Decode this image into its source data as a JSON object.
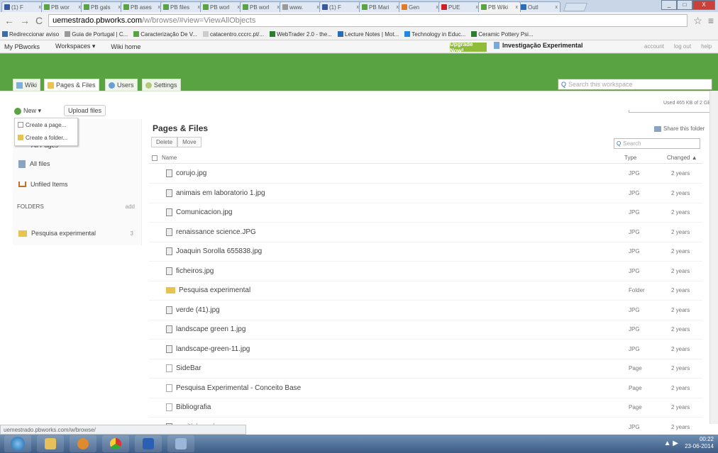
{
  "browser": {
    "tabs": [
      {
        "label": "(1) F",
        "color": "#3b5998"
      },
      {
        "label": "PB wor",
        "color": "#5aa342"
      },
      {
        "label": "PB gals",
        "color": "#5aa342"
      },
      {
        "label": "PB ases",
        "color": "#5aa342"
      },
      {
        "label": "PB files",
        "color": "#5aa342"
      },
      {
        "label": "PB worl",
        "color": "#5aa342"
      },
      {
        "label": "PB worl",
        "color": "#5aa342"
      },
      {
        "label": "www.",
        "color": "#999999"
      },
      {
        "label": "(1) F",
        "color": "#3b5998"
      },
      {
        "label": "PB Mari",
        "color": "#5aa342"
      },
      {
        "label": "Gen",
        "color": "#e07b2a"
      },
      {
        "label": "PUE",
        "color": "#cb2027"
      },
      {
        "label": "PB Wiki",
        "color": "#5aa342",
        "active": true
      },
      {
        "label": "Outl",
        "color": "#2b6cb8"
      }
    ],
    "url_host": "uemestrado.pbworks.com",
    "url_path": "/w/browse/#view=ViewAllObjects",
    "bookmarks": [
      {
        "label": "Redireccionar aviso",
        "color": "#3a6ea5"
      },
      {
        "label": "Guia de Portugal | C...",
        "color": "#999999"
      },
      {
        "label": "Caracterização De V...",
        "color": "#5aa342"
      },
      {
        "label": "catacentro.cccrc.pt/...",
        "color": "#cccccc"
      },
      {
        "label": "WebTrader 2.0 - the...",
        "color": "#2e7d32"
      },
      {
        "label": "Lecture Notes | Mot...",
        "color": "#2b6cb8"
      },
      {
        "label": "Technology in Educ...",
        "color": "#1e88e5"
      },
      {
        "label": "Ceramic Pottery Psi...",
        "color": "#2e7d32"
      }
    ]
  },
  "pbheader": {
    "brand": "My PBworks",
    "workspaces": "Workspaces ▾",
    "wiki_home": "Wiki home",
    "upgrade": "Upgrade Now!",
    "workspace_name": "Investigação Experimental",
    "account": "account",
    "logout": "log out",
    "help": "help"
  },
  "tabs": [
    {
      "label": "Wiki"
    },
    {
      "label": "Pages & Files"
    },
    {
      "label": "Users"
    },
    {
      "label": "Settings"
    }
  ],
  "search_placeholder": "Search this workspace",
  "toolbar": {
    "new": "New ▾",
    "upload": "Upload files"
  },
  "usage": "Used 465 KB of 2 GB",
  "new_menu": {
    "create_page": "Create a page...",
    "create_folder": "Create a folder..."
  },
  "sidebar": {
    "all_pages": "All Pages",
    "all_files": "All files",
    "unfiled": "Unfiled Items",
    "folders_label": "FOLDERS",
    "add": "add",
    "folder1": "Pesquisa experimental",
    "folder1_count": "3"
  },
  "main": {
    "title": "Pages & Files",
    "share": "Share this folder",
    "delete": "Delete",
    "move": "Move",
    "search_placeholder": "Search",
    "col_name": "Name",
    "col_type": "Type",
    "col_changed": "Changed ▲",
    "rows": [
      {
        "name": "corujo.jpg",
        "type": "JPG",
        "changed": "2 years",
        "icon": "file"
      },
      {
        "name": "animais em laboratorio 1.jpg",
        "type": "JPG",
        "changed": "2 years",
        "icon": "file"
      },
      {
        "name": "Comunicacion.jpg",
        "type": "JPG",
        "changed": "2 years",
        "icon": "file"
      },
      {
        "name": "renaissance science.JPG",
        "type": "JPG",
        "changed": "2 years",
        "icon": "file"
      },
      {
        "name": "Joaquin Sorolla 655838.jpg",
        "type": "JPG",
        "changed": "2 years",
        "icon": "file"
      },
      {
        "name": "ficheiros.jpg",
        "type": "JPG",
        "changed": "2 years",
        "icon": "file"
      },
      {
        "name": "Pesquisa experimental",
        "type": "Folder",
        "changed": "2 years",
        "icon": "folder"
      },
      {
        "name": "verde (41).jpg",
        "type": "JPG",
        "changed": "2 years",
        "icon": "file"
      },
      {
        "name": "landscape green 1.jpg",
        "type": "JPG",
        "changed": "2 years",
        "icon": "file"
      },
      {
        "name": "landscape-green-11.jpg",
        "type": "JPG",
        "changed": "2 years",
        "icon": "file"
      },
      {
        "name": "SideBar",
        "type": "Page",
        "changed": "2 years",
        "icon": "page"
      },
      {
        "name": "Pesquisa Experimental - Conceito Base",
        "type": "Page",
        "changed": "2 years",
        "icon": "page"
      },
      {
        "name": "Bibliografia",
        "type": "Page",
        "changed": "2 years",
        "icon": "page"
      },
      {
        "name": "positivismo.jpg",
        "type": "JPG",
        "changed": "2 years",
        "icon": "file"
      }
    ]
  },
  "statusbar": "uemestrado.pbworks.com/w/browse/",
  "clock": {
    "time": "00:22",
    "date": "23-06-2014"
  }
}
